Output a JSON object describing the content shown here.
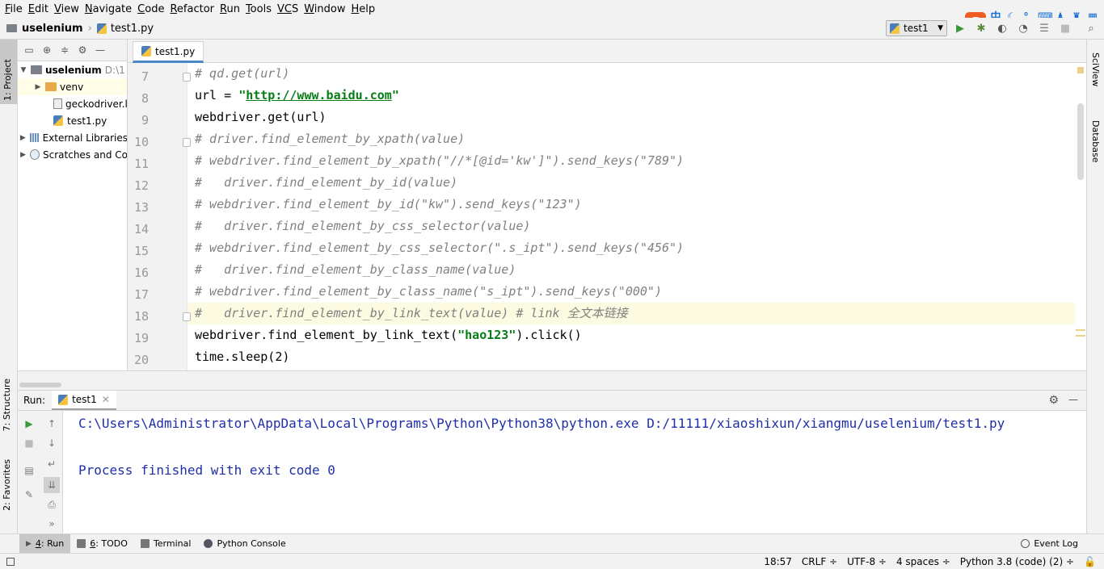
{
  "menu": [
    {
      "u": "F",
      "rest": "ile"
    },
    {
      "u": "E",
      "rest": "dit"
    },
    {
      "u": "V",
      "rest": "iew"
    },
    {
      "u": "N",
      "rest": "avigate"
    },
    {
      "u": "C",
      "rest": "ode"
    },
    {
      "u": "R",
      "rest": "efactor"
    },
    {
      "u": "R",
      "rest": "un"
    },
    {
      "u": "T",
      "rest": "ools"
    },
    {
      "u": "VC",
      "rest": "S"
    },
    {
      "u": "W",
      "rest": "indow"
    },
    {
      "u": "H",
      "rest": "elp"
    }
  ],
  "ime": {
    "logo": "S",
    "mode": "中"
  },
  "breadcrumb": {
    "project": "uselenium",
    "file": "test1.py"
  },
  "run_config": {
    "name": "test1"
  },
  "left_tabs": {
    "project": "1: Project",
    "structure": "7: Structure",
    "favorites": "2: Favorites"
  },
  "right_tabs": {
    "sciview": "SciView",
    "database": "Database"
  },
  "project_tree": {
    "root": "uselenium",
    "root_path": "D:\\1",
    "venv": "venv",
    "gecko": "geckodriver.l",
    "test1": "test1.py",
    "external": "External Libraries",
    "scratches": "Scratches and Co"
  },
  "editor": {
    "tab": "test1.py",
    "lines": [
      {
        "n": "7",
        "code": [
          {
            "c": "cm",
            "t": "# qd.get(url)"
          }
        ]
      },
      {
        "n": "8",
        "code": [
          {
            "c": "",
            "t": "url = "
          },
          {
            "c": "str",
            "t": "\""
          },
          {
            "c": "url",
            "t": "http://www.baidu.com"
          },
          {
            "c": "str",
            "t": "\""
          }
        ]
      },
      {
        "n": "9",
        "code": [
          {
            "c": "",
            "t": "webdriver.get(url)"
          }
        ]
      },
      {
        "n": "10",
        "code": [
          {
            "c": "cm",
            "t": "# driver.find_element_by_xpath(value)"
          }
        ]
      },
      {
        "n": "11",
        "code": [
          {
            "c": "cm",
            "t": "# webdriver.find_element_by_xpath(\"//*[@id='kw']\").send_keys(\"789\")"
          }
        ]
      },
      {
        "n": "12",
        "code": [
          {
            "c": "cm",
            "t": "#   driver.find_element_by_id(value)"
          }
        ]
      },
      {
        "n": "13",
        "code": [
          {
            "c": "cm",
            "t": "# webdriver.find_element_by_id(\"kw\").send_keys(\"123\")"
          }
        ]
      },
      {
        "n": "14",
        "code": [
          {
            "c": "cm",
            "t": "#   driver.find_element_by_css_selector(value)"
          }
        ]
      },
      {
        "n": "15",
        "code": [
          {
            "c": "cm",
            "t": "# webdriver.find_element_by_css_selector(\".s_ipt\").send_keys(\"456\")"
          }
        ]
      },
      {
        "n": "16",
        "code": [
          {
            "c": "cm",
            "t": "#   driver.find_element_by_class_name(value)"
          }
        ]
      },
      {
        "n": "17",
        "code": [
          {
            "c": "cm",
            "t": "# webdriver.find_element_by_class_name(\"s_ipt\").send_keys(\"000\")"
          }
        ]
      },
      {
        "n": "18",
        "code": [
          {
            "c": "cm",
            "t": "#   driver.find_element_by_link_text(value) # link 全文本链接"
          }
        ]
      },
      {
        "n": "19",
        "code": [
          {
            "c": "",
            "t": "webdriver.find_element_by_link_text("
          },
          {
            "c": "str",
            "t": "\"hao123\""
          },
          {
            "c": "",
            "t": ").click()"
          }
        ]
      },
      {
        "n": "20",
        "code": [
          {
            "c": "",
            "t": "time.sleep(2)"
          }
        ]
      }
    ]
  },
  "run_panel": {
    "label": "Run:",
    "tab": "test1",
    "output1": "C:\\Users\\Administrator\\AppData\\Local\\Programs\\Python\\Python38\\python.exe D:/11111/xiaoshixun/xiangmu/uselenium/test1.py",
    "output2": "Process finished with exit code 0"
  },
  "bottom_tabs": {
    "run_key": "4",
    "run_rest": ": Run",
    "todo_key": "6",
    "todo_rest": ": TODO",
    "terminal": "Terminal",
    "console": "Python Console",
    "eventlog": "Event Log"
  },
  "status": {
    "pos": "18:57",
    "crlf": "CRLF ÷",
    "enc": "UTF-8 ÷",
    "indent": "4 spaces ÷",
    "interp": "Python 3.8 (code) (2) ÷"
  }
}
